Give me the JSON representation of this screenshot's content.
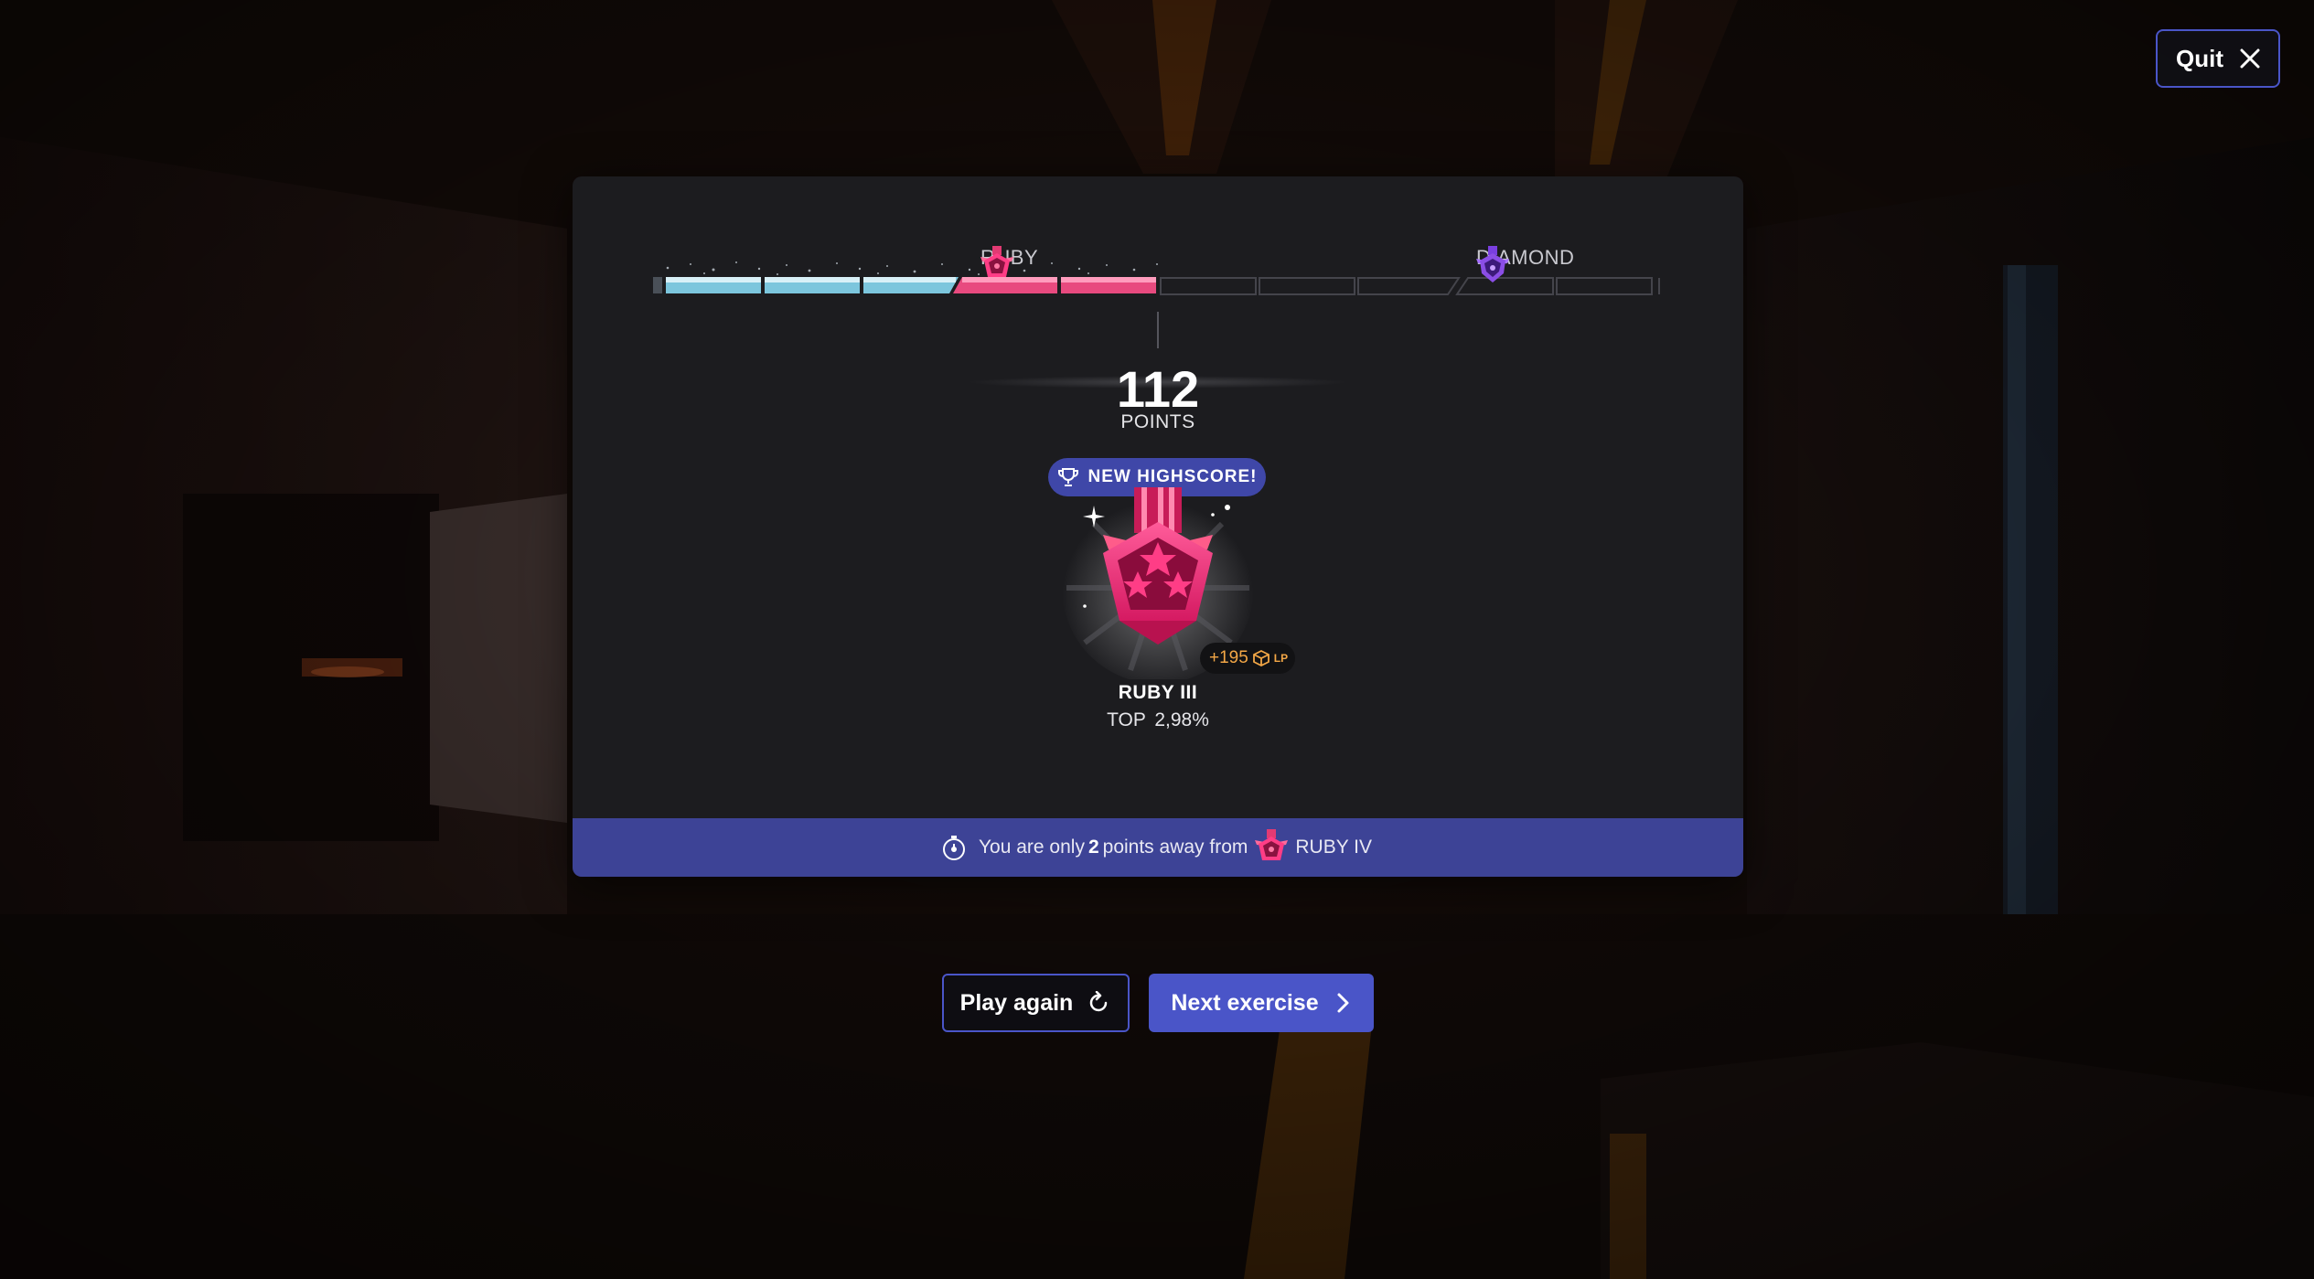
{
  "header": {
    "quit_label": "Quit",
    "quit_icon": "close-icon"
  },
  "rank_progress": {
    "current_rank_label": "RUBY",
    "next_rank_label": "DIAMOND",
    "progress_fraction": 0.5,
    "colors": {
      "completed_blue": "#7cc6dd",
      "ruby": "#e84a7f",
      "empty": "#3a3a40",
      "diamond": "#8b4ee6"
    }
  },
  "result": {
    "score": "112",
    "score_label": "POINTS",
    "highscore_badge": "NEW HIGHSCORE!",
    "lp_gain": "+195",
    "lp_unit": "LP",
    "rank_name": "RUBY III",
    "rank_top_prefix": "TOP",
    "rank_top_value": "2,98%"
  },
  "footer": {
    "text_before": "You are only",
    "points_away": "2",
    "text_after": "points away from",
    "target_rank": "RUBY IV"
  },
  "actions": {
    "play_again_label": "Play again",
    "next_exercise_label": "Next exercise"
  },
  "colors": {
    "accent": "#4a55c8",
    "banner": "#3d4396",
    "ruby_pink": "#ff3d86",
    "lp_orange": "#f3a746"
  }
}
